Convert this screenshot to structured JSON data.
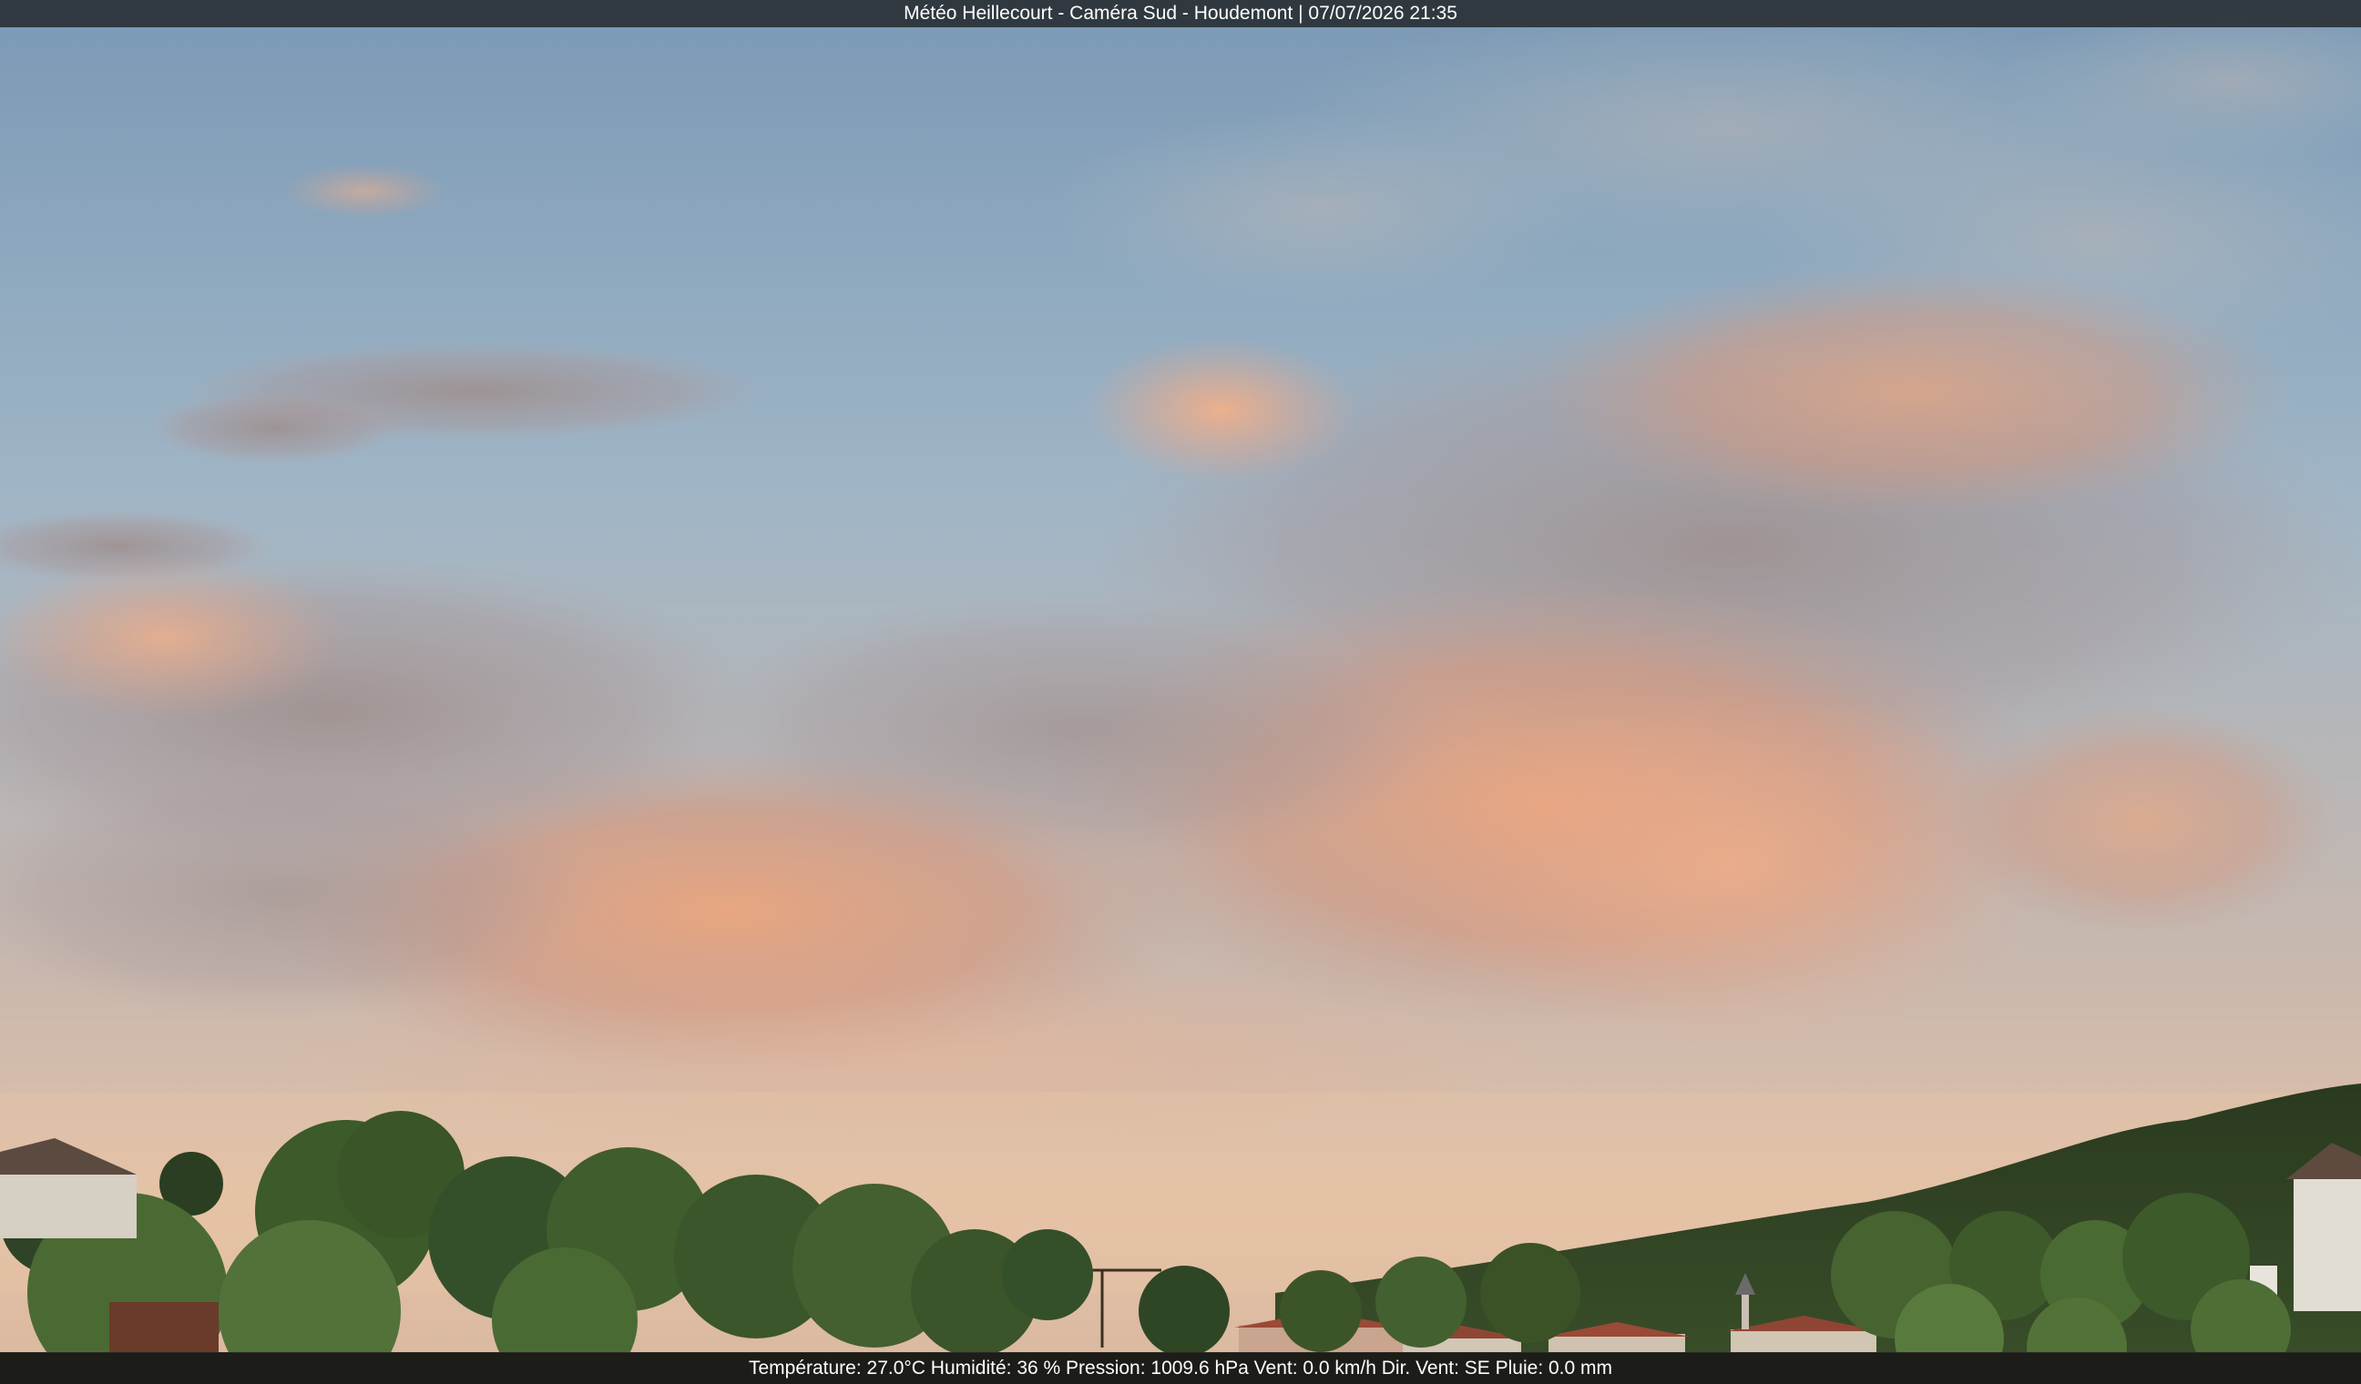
{
  "header": {
    "caption": "Météo Heillecourt - Caméra Sud - Houdemont | 07/07/2026 21:35"
  },
  "footer": {
    "caption": "Température: 27.0°C  Humidité: 36 % Pression: 1009.6 hPa Vent: 0.0 km/h Dir. Vent: SE Pluie: 0.0 mm"
  },
  "scene": {
    "sky_top_color": "#7d9cb8",
    "sky_mid_color": "#a8b9c4",
    "cloud_warm_color": "#e0a47e",
    "cloud_grey_color": "#9a8c8a",
    "horizon_glow_color": "#e8c2a4",
    "hill_color": "#2f3f22",
    "tree_color": "#3f5a2c",
    "roof_color": "#9a4a36",
    "wall_color": "#d9d2c4"
  }
}
